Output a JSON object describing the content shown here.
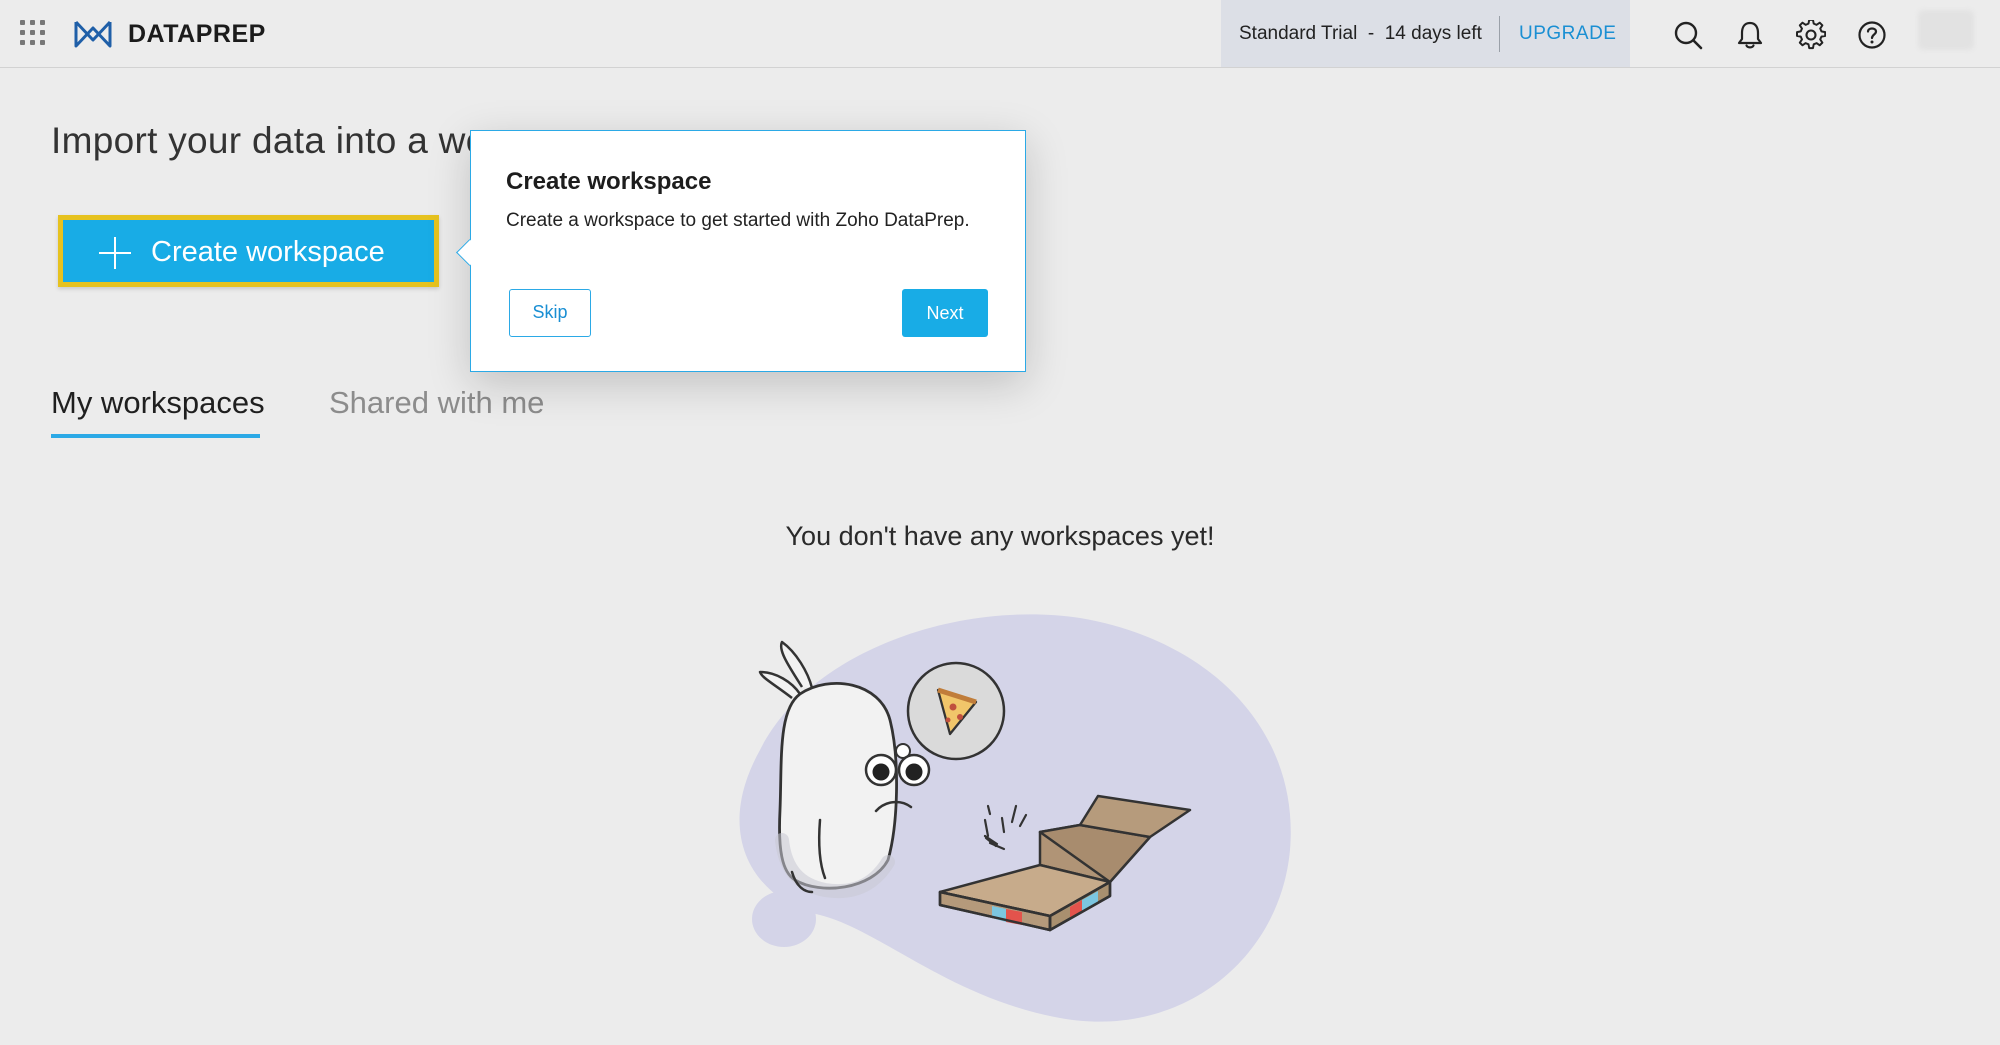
{
  "app": {
    "brand": "DATAPREP",
    "apps_icon": "grid-icon",
    "logo_icon": "dataprep-logo-icon"
  },
  "topbar": {
    "trial_text": "Standard Trial  -  14 days left",
    "upgrade_label": "UPGRADE",
    "icons": [
      "search-icon",
      "bell-icon",
      "gear-icon",
      "help-icon"
    ]
  },
  "main": {
    "heading": "Import your data into a wo",
    "create_workspace_label": "Create workspace",
    "tabs": [
      {
        "label": "My workspaces",
        "active": true
      },
      {
        "label": "Shared with me",
        "active": false
      }
    ],
    "empty_message": "You don't have any workspaces yet!"
  },
  "popover": {
    "title": "Create workspace",
    "description": "Create a workspace to get started with Zoho DataPrep.",
    "skip_label": "Skip",
    "next_label": "Next"
  },
  "colors": {
    "accent": "#18ace6",
    "highlight_border": "#e6c21f",
    "background": "#ececec",
    "blob": "#d4d4e8"
  }
}
